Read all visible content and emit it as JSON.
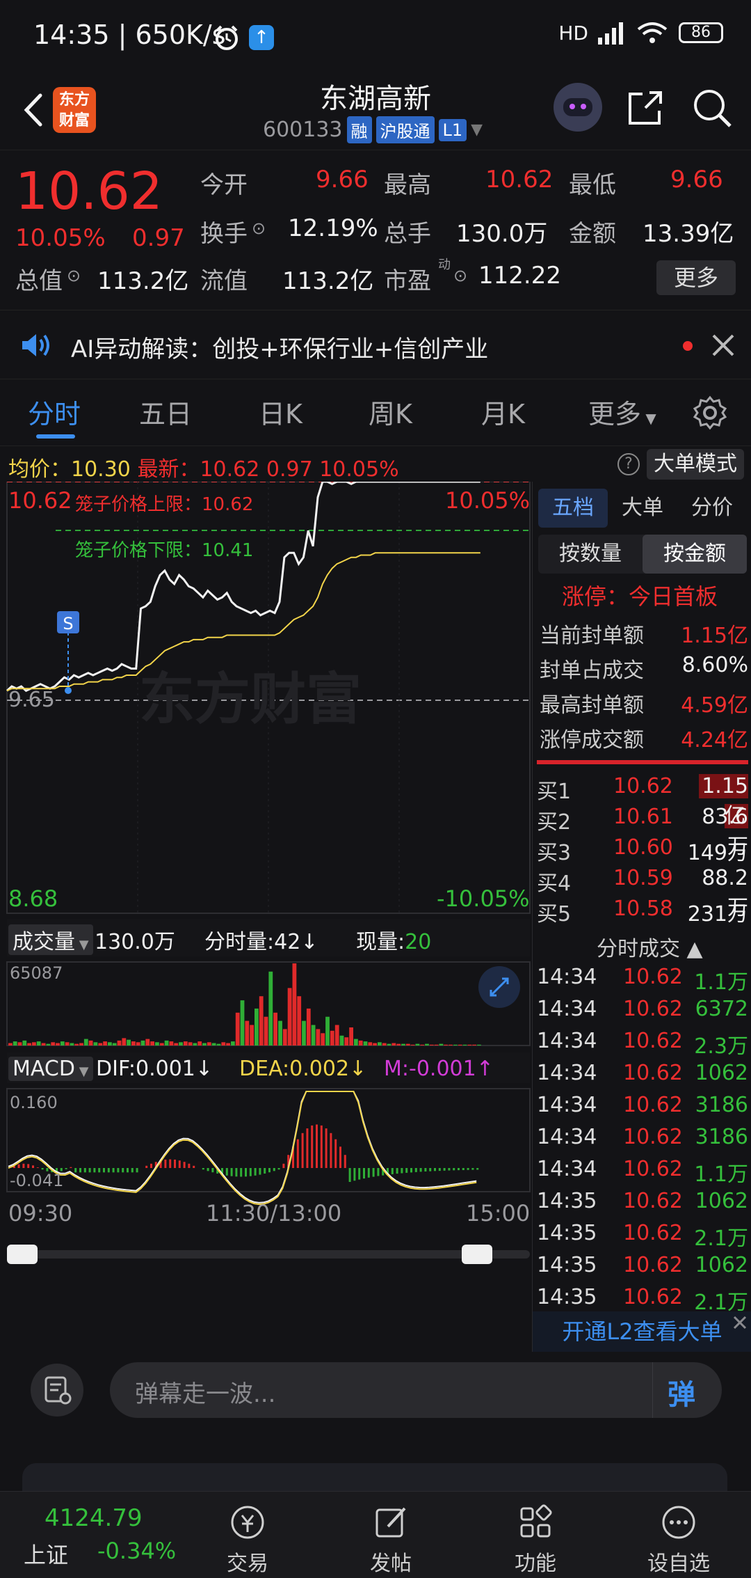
{
  "status_bar": {
    "time": "14:35 | 650K/s",
    "network": "HD",
    "battery": "86"
  },
  "header": {
    "logo_text": "东方财富",
    "stock_name": "东湖高新",
    "stock_code": "600133",
    "tags": [
      "融",
      "沪股通",
      "L1"
    ]
  },
  "quote": {
    "price": "10.62",
    "change_pct": "10.05%",
    "change_abs": "0.97",
    "fields": [
      {
        "label": "今开",
        "value": "9.66"
      },
      {
        "label": "最高",
        "value": "10.62"
      },
      {
        "label": "最低",
        "value": "9.66"
      },
      {
        "label": "换手",
        "value": "12.19%"
      },
      {
        "label": "总手",
        "value": "130.0万"
      },
      {
        "label": "金额",
        "value": "13.39亿"
      },
      {
        "label": "总值",
        "value": "113.2亿"
      },
      {
        "label": "流值",
        "value": "113.2亿"
      },
      {
        "label": "市盈",
        "value": "112.22"
      }
    ],
    "pe_superscript": "动",
    "more_label": "更多"
  },
  "ai_banner": {
    "text": "AI异动解读：创投+环保行业+信创产业"
  },
  "tabs": [
    "分时",
    "五日",
    "日K",
    "周K",
    "月K",
    "更多"
  ],
  "avg_bar": {
    "avg_label": "均价：",
    "avg_value": "10.30",
    "latest_label": "最新：",
    "latest_value": "10.62",
    "latest_chg": "0.97",
    "latest_pct": "10.05%",
    "big_order_mode": "大单模式"
  },
  "chart_data": {
    "type": "line",
    "price_axis": {
      "top": "10.62",
      "top_pct": "10.05%",
      "bottom": "8.68",
      "bottom_pct": "-10.05%",
      "prev_close": "9.65"
    },
    "upper_limit_label": "笼子价格上限：10.62",
    "lower_limit_label": "笼子价格下限：10.41",
    "signal_marker": "S",
    "watermark": "东方财富",
    "x_labels": [
      "09:30",
      "11:30/13:00",
      "15:00"
    ],
    "series": [
      {
        "values": [
          9.68,
          9.7,
          9.69,
          9.7,
          9.68,
          9.69,
          9.7,
          9.71,
          9.7,
          9.69,
          9.7,
          9.72,
          9.74,
          9.73,
          9.75,
          9.74,
          9.75,
          9.76,
          9.75,
          9.76,
          9.77,
          9.78,
          9.77,
          9.78,
          9.8,
          9.79,
          9.78,
          9.78,
          10.05,
          10.06,
          10.08,
          10.15,
          10.2,
          10.22,
          10.18,
          10.16,
          10.2,
          10.18,
          10.15,
          10.14,
          10.12,
          10.1,
          10.13,
          10.11,
          10.09,
          10.1,
          10.12,
          10.08,
          10.06,
          10.05,
          10.04,
          10.03,
          10.04,
          10.02,
          10.03,
          10.04,
          10.03,
          10.08,
          10.28,
          10.3,
          10.3,
          10.25,
          10.28,
          10.4,
          10.33,
          10.55,
          10.62,
          10.62,
          10.61,
          10.62,
          10.62,
          10.62,
          10.61,
          10.62,
          10.62,
          10.62,
          10.62,
          10.62,
          10.62,
          10.62,
          10.62,
          10.62,
          10.62,
          10.62,
          10.62,
          10.62,
          10.62,
          10.62,
          10.62,
          10.62,
          10.62,
          10.62,
          10.62,
          10.62,
          10.62,
          10.62,
          10.62,
          10.62,
          10.62,
          10.62
        ]
      },
      {
        "values": [
          9.68,
          9.69,
          9.69,
          9.69,
          9.69,
          9.69,
          9.69,
          9.69,
          9.69,
          9.69,
          9.69,
          9.7,
          9.7,
          9.7,
          9.71,
          9.71,
          9.71,
          9.72,
          9.72,
          9.72,
          9.73,
          9.73,
          9.73,
          9.74,
          9.74,
          9.75,
          9.75,
          9.75,
          9.77,
          9.79,
          9.8,
          9.82,
          9.84,
          9.86,
          9.87,
          9.88,
          9.89,
          9.9,
          9.9,
          9.91,
          9.91,
          9.91,
          9.92,
          9.92,
          9.92,
          9.92,
          9.93,
          9.93,
          9.93,
          9.93,
          9.93,
          9.93,
          9.93,
          9.93,
          9.93,
          9.93,
          9.93,
          9.94,
          9.96,
          9.98,
          10.0,
          10.01,
          10.02,
          10.04,
          10.06,
          10.1,
          10.16,
          10.2,
          10.23,
          10.25,
          10.26,
          10.27,
          10.28,
          10.28,
          10.29,
          10.29,
          10.29,
          10.3,
          10.3,
          10.3,
          10.3,
          10.3,
          10.3,
          10.3,
          10.3,
          10.3,
          10.3,
          10.3,
          10.3,
          10.3,
          10.3,
          10.3,
          10.3,
          10.3,
          10.3,
          10.3,
          10.3,
          10.3,
          10.3,
          10.3
        ]
      }
    ],
    "ylim": [
      8.68,
      10.62
    ]
  },
  "volume": {
    "label": "成交量",
    "total": "130.0万",
    "tick_label": "分时量:42",
    "tick_arrow": "↓",
    "now_label": "现量:",
    "now_value": "20",
    "max": "65087",
    "bars": [
      3,
      5,
      4,
      6,
      3,
      4,
      5,
      3,
      2,
      4,
      3,
      5,
      4,
      3,
      2,
      3,
      8,
      6,
      4,
      3,
      5,
      4,
      3,
      6,
      9,
      7,
      5,
      4,
      6,
      8,
      5,
      4,
      3,
      6,
      5,
      3,
      4,
      5,
      4,
      3,
      5,
      3,
      4,
      3,
      2,
      4,
      3,
      5,
      40,
      55,
      30,
      25,
      45,
      60,
      35,
      90,
      40,
      30,
      20,
      70,
      100,
      60,
      30,
      45,
      25,
      20,
      15,
      35,
      18,
      25,
      12,
      10,
      22,
      8,
      6,
      5,
      4,
      3,
      4,
      3,
      2,
      3,
      2,
      2,
      2,
      1,
      2,
      1,
      2,
      1,
      1,
      2,
      1,
      1,
      1,
      1,
      1,
      1,
      1,
      1
    ],
    "colors": "rgrgrrgrgrrgrgrrgrgrrggrrgrrgrrgrgrrgrrgrgrggrrgrgrrgrrgrgrrrrgrgrrgrrgrrgrgrrgrgrrgrrgrgrrgrrgrgrrg"
  },
  "macd": {
    "label": "MACD",
    "dif": "DIF:0.001↓",
    "dea": "DEA:0.002↓",
    "m": "M:-0.001↑",
    "max": "0.160",
    "min": "-0.041"
  },
  "right_panel": {
    "tabs": [
      "五档",
      "大单",
      "分价"
    ],
    "segments": [
      "按数量",
      "按金额"
    ],
    "limit_up_title": "涨停：今日首板",
    "stats": [
      {
        "label": "当前封单额",
        "value": "1.15亿",
        "color": "red"
      },
      {
        "label": "封单占成交",
        "value": "8.60%",
        "color": "white"
      },
      {
        "label": "最高封单额",
        "value": "4.59亿",
        "color": "red"
      },
      {
        "label": "涨停成交额",
        "value": "4.24亿",
        "color": "red"
      }
    ],
    "book": [
      {
        "level": "买1",
        "price": "10.62",
        "amount": "1.15亿"
      },
      {
        "level": "买2",
        "price": "10.61",
        "amount": "83.6万"
      },
      {
        "level": "买3",
        "price": "10.60",
        "amount": "149万"
      },
      {
        "level": "买4",
        "price": "10.59",
        "amount": "88.2万"
      },
      {
        "level": "买5",
        "price": "10.58",
        "amount": "231万"
      }
    ],
    "ticks_title": "分时成交",
    "ticks": [
      {
        "time": "14:34",
        "price": "10.62",
        "amount": "1.1万"
      },
      {
        "time": "14:34",
        "price": "10.62",
        "amount": "6372"
      },
      {
        "time": "14:34",
        "price": "10.62",
        "amount": "2.3万"
      },
      {
        "time": "14:34",
        "price": "10.62",
        "amount": "1062"
      },
      {
        "time": "14:34",
        "price": "10.62",
        "amount": "3186"
      },
      {
        "time": "14:34",
        "price": "10.62",
        "amount": "3186"
      },
      {
        "time": "14:34",
        "price": "10.62",
        "amount": "1.1万"
      },
      {
        "time": "14:35",
        "price": "10.62",
        "amount": "1062"
      },
      {
        "time": "14:35",
        "price": "10.62",
        "amount": "2.1万"
      },
      {
        "time": "14:35",
        "price": "10.62",
        "amount": "1062"
      },
      {
        "time": "14:35",
        "price": "10.62",
        "amount": "2.1万"
      }
    ],
    "l2_banner": "开通L2查看大单"
  },
  "comment": {
    "placeholder": "弹幕走一波...",
    "send_label": "弹"
  },
  "nav": {
    "index_value": "4124.79",
    "index_name": "上证",
    "index_chg": "-0.34%",
    "items": [
      "交易",
      "发帖",
      "功能",
      "设自选"
    ]
  }
}
